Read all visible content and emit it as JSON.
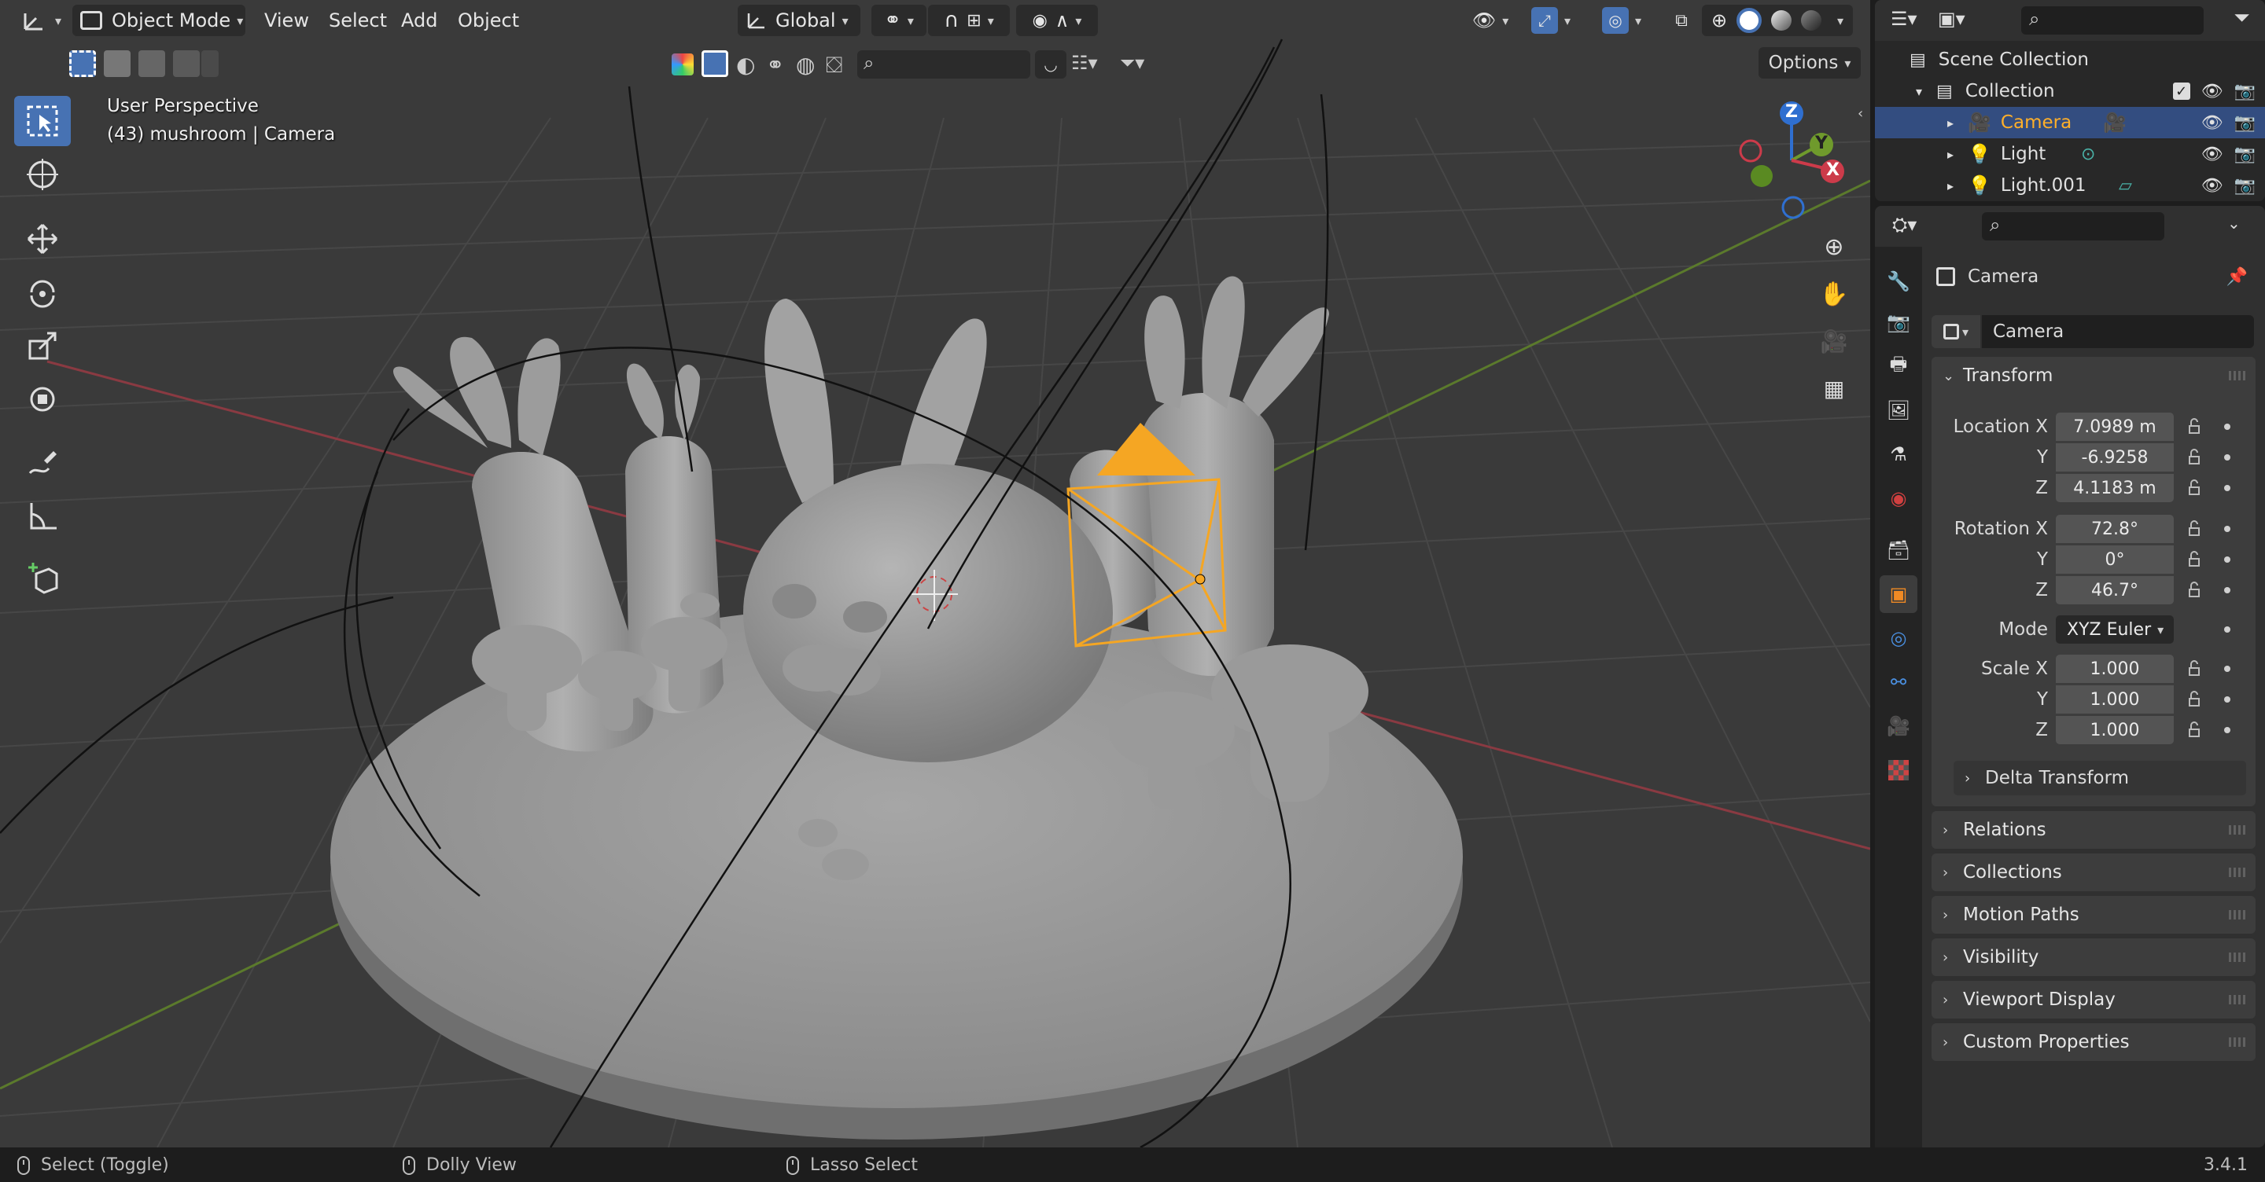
{
  "viewport": {
    "mode_label": "Object Mode",
    "menus": [
      "View",
      "Select",
      "Add",
      "Object"
    ],
    "transform_orientation": "Global",
    "options_label": "Options",
    "overlay_perspective": "User Perspective",
    "overlay_object": "(43) mushroom | Camera",
    "gizmo_axes": {
      "z": "Z",
      "y": "Y",
      "x": "X"
    },
    "colors": {
      "select_orange": "#f5a623",
      "active_blue": "#4772b3",
      "x_axis": "#cc3b4a",
      "y_axis": "#6f9a2c",
      "z_axis": "#2f6fd0"
    }
  },
  "outliner": {
    "root": "Scene Collection",
    "collection": "Collection",
    "items": [
      {
        "name": "Camera",
        "selected": true
      },
      {
        "name": "Light",
        "selected": false
      },
      {
        "name": "Light.001",
        "selected": false
      }
    ]
  },
  "properties": {
    "object_name_title": "Camera",
    "object_name_field": "Camera",
    "transform": {
      "title": "Transform",
      "location_label": "Location X",
      "location": [
        "7.0989 m",
        "-6.9258",
        "4.1183 m"
      ],
      "rotation_label": "Rotation X",
      "rotation": [
        "72.8°",
        "0°",
        "46.7°"
      ],
      "y_label": "Y",
      "z_label": "Z",
      "mode_label": "Mode",
      "mode_value": "XYZ Euler",
      "scale_label": "Scale X",
      "scale": [
        "1.000",
        "1.000",
        "1.000"
      ],
      "delta": "Delta Transform"
    },
    "panels": [
      "Relations",
      "Collections",
      "Motion Paths",
      "Visibility",
      "Viewport Display",
      "Custom Properties"
    ]
  },
  "statusbar": {
    "left": "Select (Toggle)",
    "middle": "Dolly View",
    "right": "Lasso Select",
    "version": "3.4.1"
  }
}
